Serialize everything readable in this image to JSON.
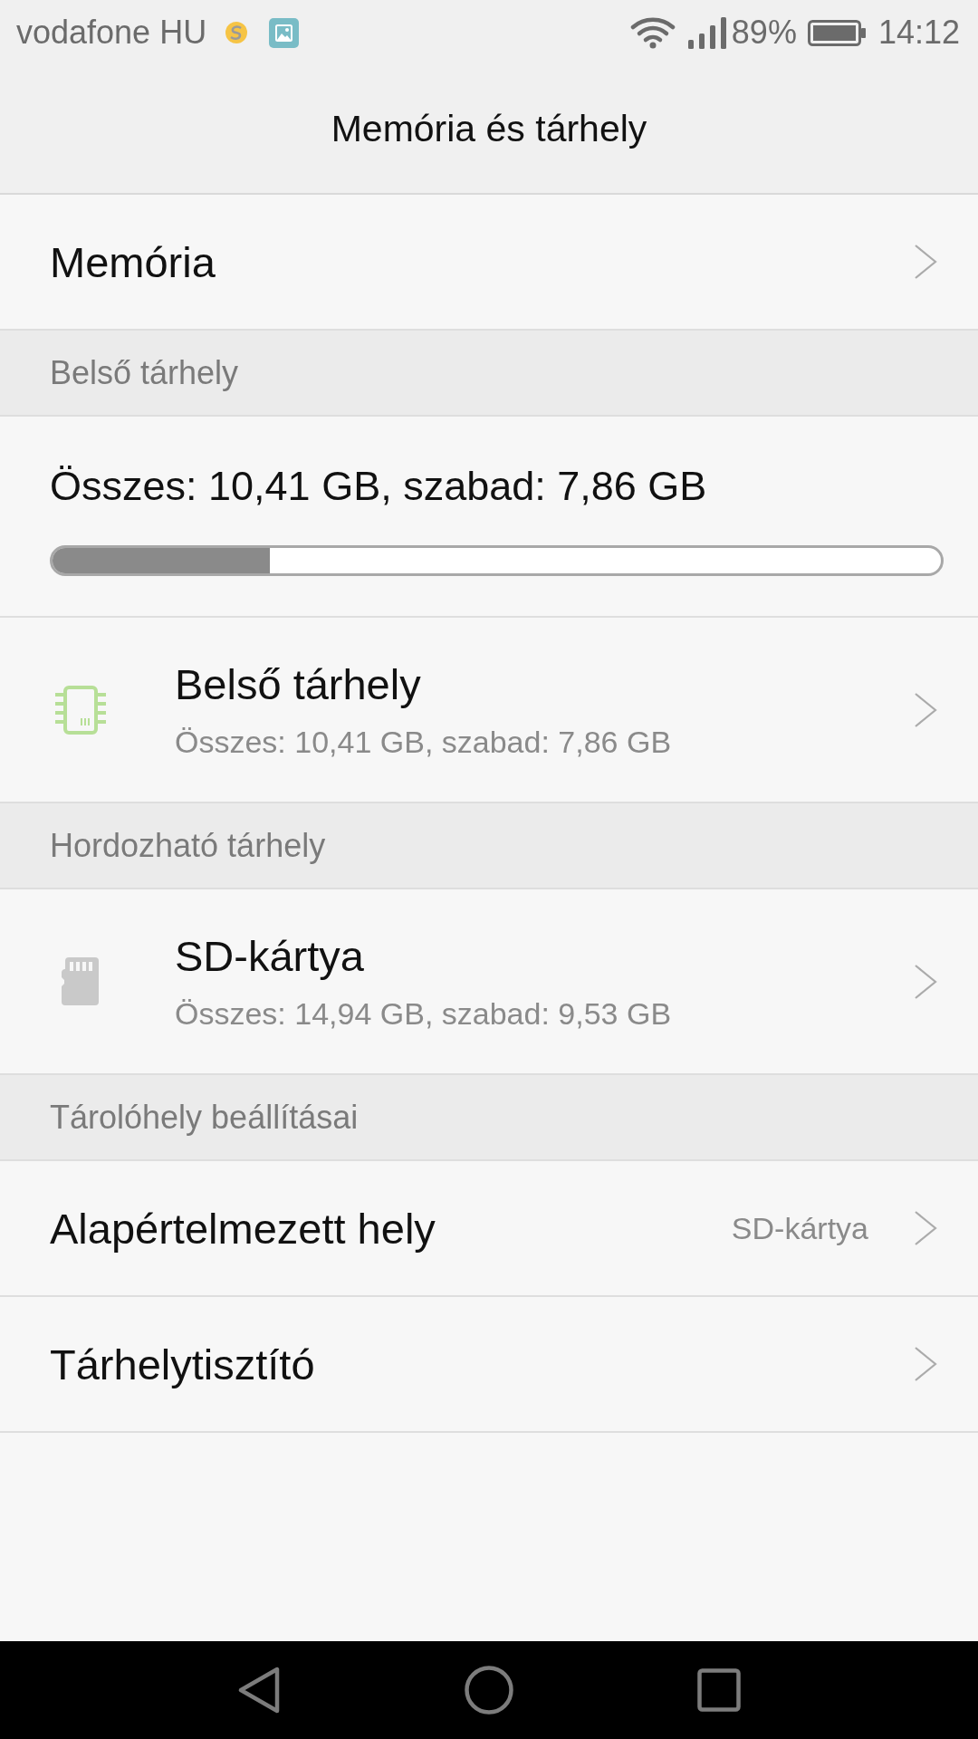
{
  "status_bar": {
    "carrier": "vodafone HU",
    "battery": "89%",
    "time": "14:12"
  },
  "app_bar": {
    "title": "Memória és tárhely"
  },
  "list": [
    {
      "kind": "link",
      "title": "Memória"
    },
    {
      "kind": "section",
      "title": "Belső tárhely"
    },
    {
      "kind": "usage",
      "text": "Összes: 10,41 GB, szabad: 7,86 GB",
      "level": 0.245
    },
    {
      "kind": "internal",
      "title": "Belső tárhely",
      "subtitle": "Összes: 10,41 GB, szabad: 7,86 GB"
    },
    {
      "kind": "section",
      "title": "Hordozható tárhely"
    },
    {
      "kind": "removable",
      "title": "SD-kártya",
      "subtitle": "Összes: 14,94 GB, szabad: 9,53 GB"
    },
    {
      "kind": "section",
      "title": "Tárolóhely beállításai"
    },
    {
      "kind": "link",
      "title": "Alapértelmezett hely",
      "value": "SD-kártya"
    },
    {
      "kind": "link",
      "title": "Tárhelytisztító"
    }
  ]
}
